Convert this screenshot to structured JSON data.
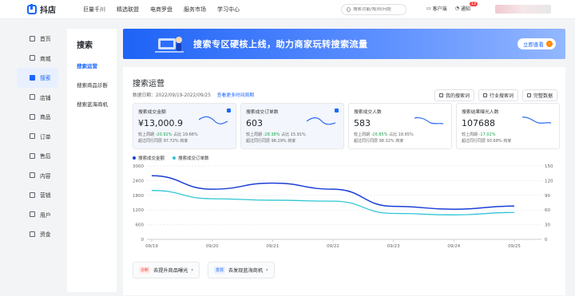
{
  "app": {
    "name": "抖店"
  },
  "topnav": [
    "巨量千川",
    "精选联盟",
    "电商罗盘",
    "服务市场",
    "学习中心"
  ],
  "search": {
    "placeholder": "搜索功能/规则/问题"
  },
  "top_right": {
    "service_label": "客户端",
    "notice_label": "通知",
    "notice_count": "13"
  },
  "sidebar": {
    "items": [
      {
        "label": "首页",
        "icon": "home-icon"
      },
      {
        "label": "商城",
        "icon": "mall-icon"
      },
      {
        "label": "搜索",
        "icon": "search-icon",
        "active": true
      },
      {
        "label": "店铺",
        "icon": "shop-icon"
      },
      {
        "label": "商品",
        "icon": "goods-icon"
      },
      {
        "label": "订单",
        "icon": "order-icon"
      },
      {
        "label": "售后",
        "icon": "aftersale-icon"
      },
      {
        "label": "内容",
        "icon": "content-icon"
      },
      {
        "label": "营销",
        "icon": "marketing-icon"
      },
      {
        "label": "用户",
        "icon": "user-icon"
      },
      {
        "label": "资金",
        "icon": "funds-icon"
      }
    ]
  },
  "subnav": {
    "title": "搜索",
    "items": [
      "搜索运营",
      "搜索商品诊断",
      "搜索蓝海商机"
    ]
  },
  "banner": {
    "text": "搜索专区硬核上线，助力商家玩转搜索流量",
    "button": "立即查看"
  },
  "card": {
    "title": "搜索运营",
    "date_label": "数据日期：2022/09/19-2022/09/25",
    "more_link": "查看更多时间周期",
    "actions": [
      "我的搜索词",
      "行业搜索词",
      "完整数据"
    ]
  },
  "kpis": [
    {
      "label": "搜索成交金额",
      "value": "¥13,000.9",
      "change_prefix": "较上周期",
      "change": "-20.92%",
      "share": "占比 19.66%",
      "rank": "超过同行同层 97.72% 商家",
      "selected": true
    },
    {
      "label": "搜索成交订单数",
      "value": "603",
      "change_prefix": "较上周期",
      "change": "-28.38%",
      "share": "占比 15.91%",
      "rank": "超过同行同层 98.29% 商家",
      "selected": true
    },
    {
      "label": "搜索成交人数",
      "value": "583",
      "change_prefix": "较上周期",
      "change": "-26.85%",
      "share": "占比 18.65%",
      "rank": "超过同行同层 98.32% 商家",
      "selected": false
    },
    {
      "label": "搜索结果曝光人数",
      "value": "107688",
      "change_prefix": "较上周期",
      "change": "-17.02%",
      "share": "",
      "rank": "超过同行同层 93.68% 商家",
      "selected": false
    }
  ],
  "colors": {
    "series1": "#1a3fd6",
    "series2": "#2fc6d6",
    "accent": "#1966ff"
  },
  "chart_data": {
    "type": "line",
    "x": [
      "09/19",
      "09/20",
      "09/21",
      "09/22",
      "09/23",
      "09/24",
      "09/25"
    ],
    "series": [
      {
        "name": "搜索成交金额",
        "axis": "left",
        "values": [
          2600,
          2050,
          2300,
          2050,
          1350,
          1230,
          1360
        ]
      },
      {
        "name": "搜索成交订单数",
        "axis": "right",
        "values": [
          100,
          83,
          80,
          78,
          53,
          50,
          55
        ]
      }
    ],
    "ylim_left": [
      0,
      3000
    ],
    "yticks_left": [
      0,
      600,
      1200,
      1800,
      2400,
      3000
    ],
    "ylim_right": [
      0,
      150
    ],
    "yticks_right": [
      0,
      30,
      60,
      90,
      120,
      150
    ],
    "legend": "top-left",
    "grid": true
  },
  "tips": [
    {
      "tag": "诊断",
      "text": "去提升商品曝光"
    },
    {
      "tag": "发现",
      "text": "去发现蓝海商机"
    }
  ]
}
